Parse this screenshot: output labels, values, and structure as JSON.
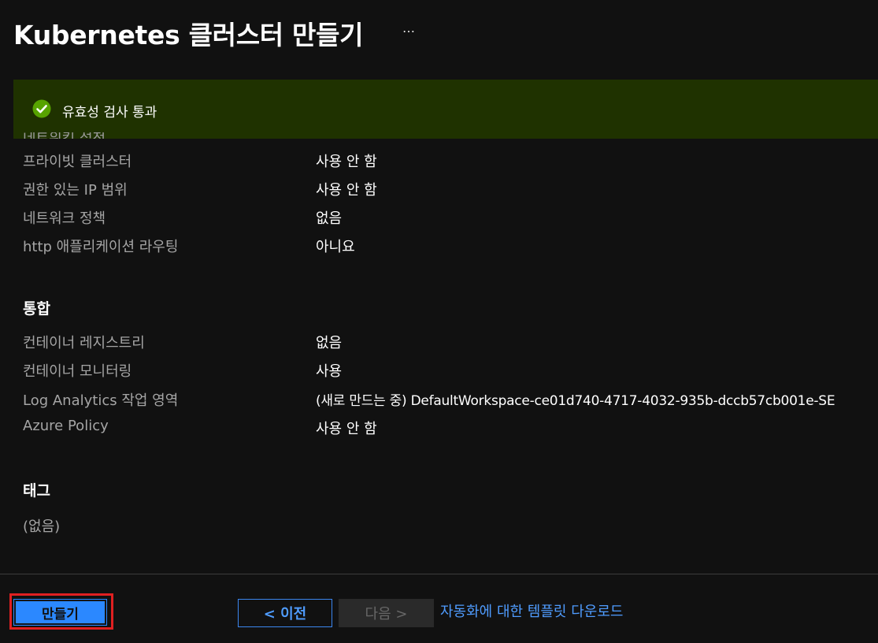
{
  "header": {
    "title": "Kubernetes 클러스터 만들기",
    "more_label": "…"
  },
  "validation": {
    "message": "유효성 검사 통과",
    "icon": "check-circle-icon",
    "peek_text": "네트워킹 설정"
  },
  "networking": {
    "rows": [
      {
        "label": "프라이빗 클러스터",
        "value": "사용 안 함"
      },
      {
        "label": "권한 있는 IP 범위",
        "value": "사용 안 함"
      },
      {
        "label": "네트워크 정책",
        "value": "없음"
      },
      {
        "label": "http 애플리케이션 라우팅",
        "value": "아니요"
      }
    ]
  },
  "integration": {
    "heading": "통합",
    "rows": [
      {
        "label": "컨테이너 레지스트리",
        "value": "없음"
      },
      {
        "label": "컨테이너 모니터링",
        "value": "사용"
      },
      {
        "label": "Log Analytics 작업 영역",
        "value": "(새로 만드는 중) DefaultWorkspace-ce01d740-4717-4032-935b-dccb57cb001e-SE"
      },
      {
        "label": "Azure Policy",
        "value": "사용 안 함"
      }
    ]
  },
  "tags": {
    "heading": "태그",
    "empty_text": "(없음)"
  },
  "footer": {
    "create_label": "만들기",
    "prev_label": "< 이전",
    "next_label": "다음 >",
    "download_link": "자동화에 대한 템플릿 다운로드"
  },
  "colors": {
    "banner_bg": "#1f3200",
    "success_green": "#57a300",
    "accent_blue": "#2b88ff",
    "focus_red": "#e02021"
  }
}
